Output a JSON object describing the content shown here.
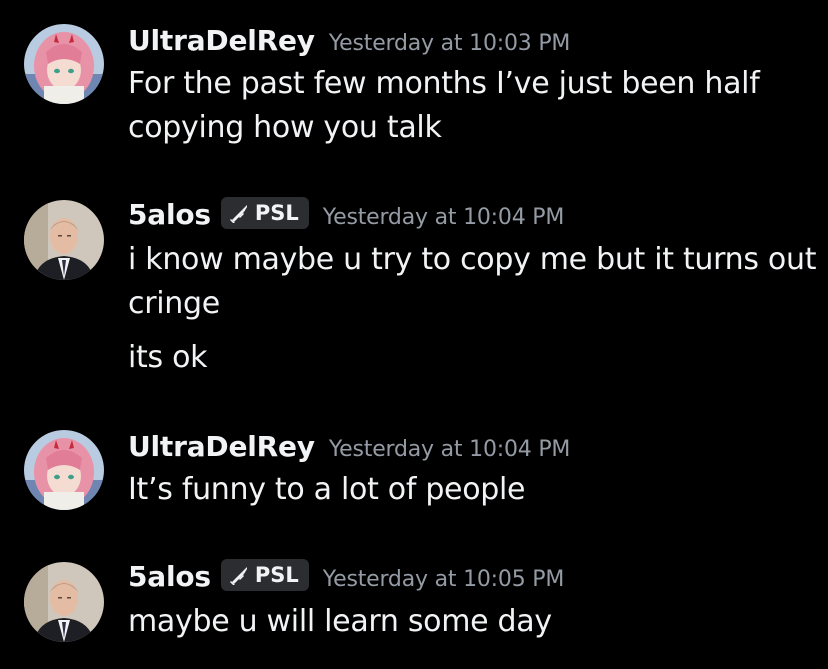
{
  "messages": [
    {
      "username": "UltraDelRey",
      "timestamp": "Yesterday at 10:03 PM",
      "avatar_icon": "anime-girl-avatar-icon",
      "lines": [
        "For the past few months I’ve just been half",
        "copying how you talk"
      ]
    },
    {
      "username": "5alos",
      "role_tag": "PSL",
      "role_icon": "sword-icon",
      "timestamp": "Yesterday at 10:04 PM",
      "avatar_icon": "man-in-suit-avatar-icon",
      "lines": [
        "i know maybe u try to copy me but it turns out",
        "cringe",
        "its ok"
      ]
    },
    {
      "username": "UltraDelRey",
      "timestamp": "Yesterday at 10:04 PM",
      "avatar_icon": "anime-girl-avatar-icon",
      "lines": [
        "It’s funny to a lot of people"
      ]
    },
    {
      "username": "5alos",
      "role_tag": "PSL",
      "role_icon": "sword-icon",
      "timestamp": "Yesterday at 10:05 PM",
      "avatar_icon": "man-in-suit-avatar-icon",
      "lines": [
        "maybe u will learn some day"
      ]
    }
  ],
  "colors": {
    "background": "#000000",
    "text": "#f2f3f5",
    "timestamp": "#949ba4",
    "tag_background": "#2b2d31"
  }
}
